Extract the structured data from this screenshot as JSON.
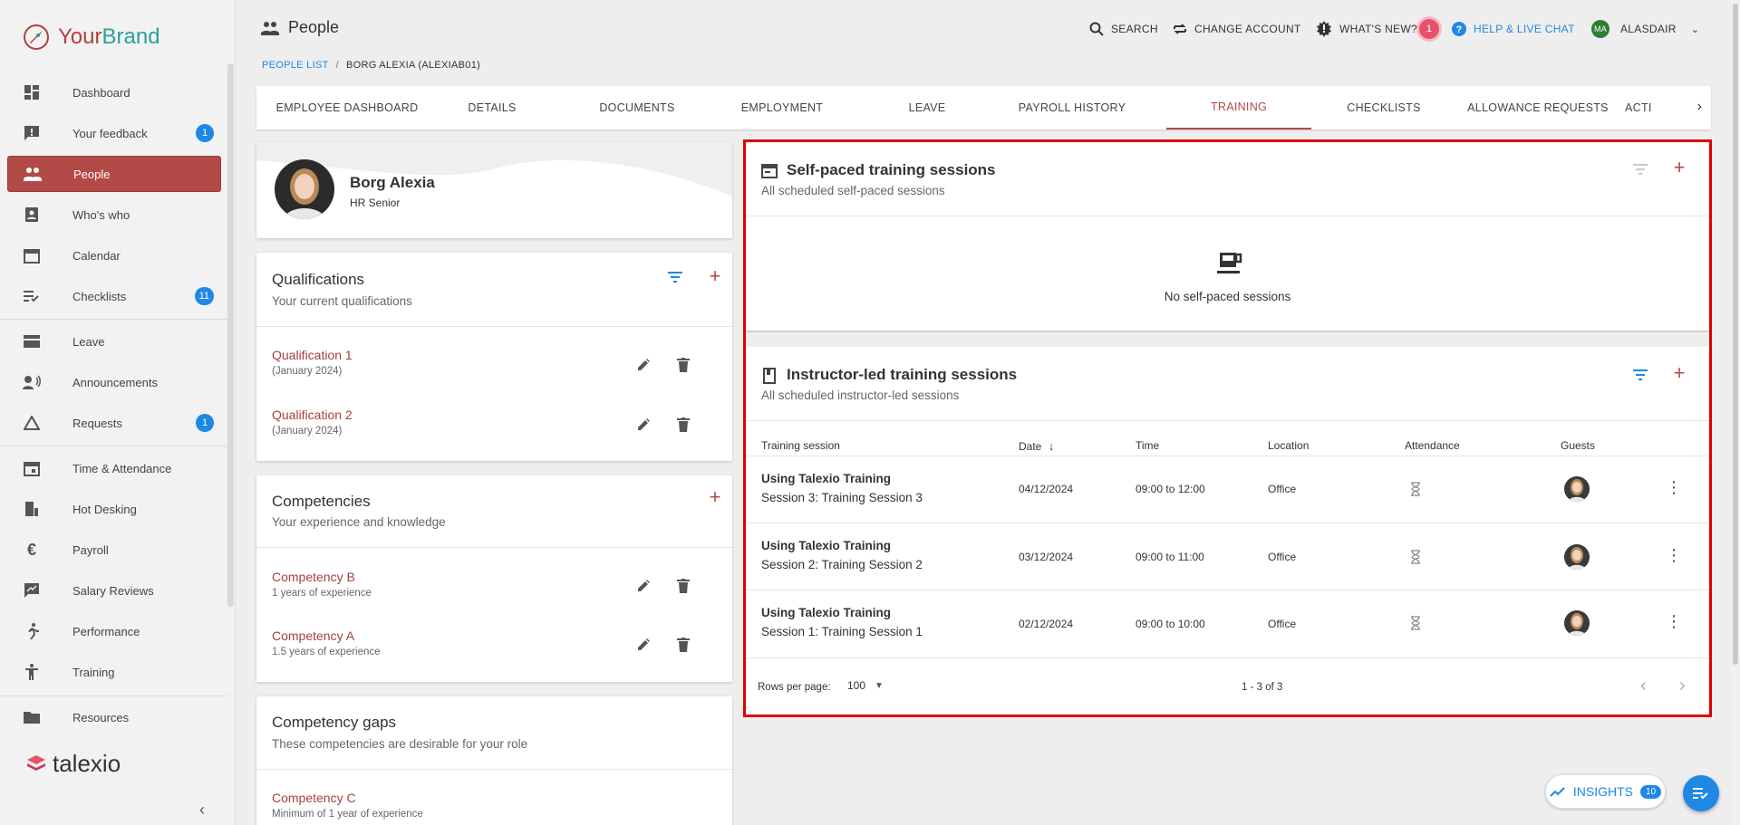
{
  "brand": {
    "part1": "Your",
    "part2": "Brand"
  },
  "sidebar": {
    "items": [
      {
        "label": "Dashboard",
        "icon": "dashboard-icon",
        "badge": ""
      },
      {
        "label": "Your feedback",
        "icon": "feedback-icon",
        "badge": "1"
      },
      {
        "label": "People",
        "icon": "people-icon",
        "badge": ""
      },
      {
        "label": "Who's who",
        "icon": "contact-icon",
        "badge": ""
      },
      {
        "label": "Calendar",
        "icon": "calendar-icon",
        "badge": ""
      },
      {
        "label": "Checklists",
        "icon": "checklist-icon",
        "badge": "11"
      },
      {
        "label": "Leave",
        "icon": "leave-icon",
        "badge": ""
      },
      {
        "label": "Announcements",
        "icon": "announcement-icon",
        "badge": ""
      },
      {
        "label": "Requests",
        "icon": "requests-icon",
        "badge": "1"
      },
      {
        "label": "Time & Attendance",
        "icon": "time-icon",
        "badge": ""
      },
      {
        "label": "Hot Desking",
        "icon": "desk-icon",
        "badge": ""
      },
      {
        "label": "Payroll",
        "icon": "euro-icon",
        "badge": ""
      },
      {
        "label": "Salary Reviews",
        "icon": "salary-review-icon",
        "badge": ""
      },
      {
        "label": "Performance",
        "icon": "performance-icon",
        "badge": ""
      },
      {
        "label": "Training",
        "icon": "training-icon",
        "badge": ""
      },
      {
        "label": "Resources",
        "icon": "folder-icon",
        "badge": ""
      }
    ],
    "footer_logo": "talexio"
  },
  "header": {
    "title": "People",
    "search": "SEARCH",
    "change_account": "CHANGE ACCOUNT",
    "whats_new": "WHAT'S NEW?",
    "whats_new_count": "1",
    "help": "HELP & LIVE CHAT",
    "user_initials": "MA",
    "user": "ALASDAIR"
  },
  "breadcrumb": {
    "link": "PEOPLE LIST",
    "sep": "/",
    "current": "BORG ALEXIA (ALEXIAB01)"
  },
  "tabs": [
    "EMPLOYEE DASHBOARD",
    "DETAILS",
    "DOCUMENTS",
    "EMPLOYMENT",
    "LEAVE",
    "PAYROLL HISTORY",
    "TRAINING",
    "CHECKLISTS",
    "ALLOWANCE REQUESTS",
    "ACTI"
  ],
  "profile": {
    "name": "Borg Alexia",
    "role": "HR Senior"
  },
  "qualifications": {
    "title": "Qualifications",
    "subtitle": "Your current qualifications",
    "items": [
      {
        "name": "Qualification 1",
        "date": "(January 2024)"
      },
      {
        "name": "Qualification 2",
        "date": "(January 2024)"
      }
    ]
  },
  "competencies": {
    "title": "Competencies",
    "subtitle": "Your experience and knowledge",
    "items": [
      {
        "name": "Competency B",
        "detail": "1 years of experience"
      },
      {
        "name": "Competency A",
        "detail": "1.5 years of experience"
      }
    ]
  },
  "gaps": {
    "title": "Competency gaps",
    "subtitle": "These competencies are desirable for your role",
    "items": [
      {
        "name": "Competency C",
        "detail": "Minimum of 1 year of experience"
      }
    ]
  },
  "self_paced": {
    "title": "Self-paced training sessions",
    "subtitle": "All scheduled self-paced sessions",
    "empty": "No self-paced sessions"
  },
  "instructor": {
    "title": "Instructor-led training sessions",
    "subtitle": "All scheduled instructor-led sessions",
    "columns": [
      "Training session",
      "Date",
      "Time",
      "Location",
      "Attendance",
      "Guests"
    ],
    "rows": [
      {
        "course": "Using Talexio Training",
        "session": "Session 3: Training Session 3",
        "date": "04/12/2024",
        "time": "09:00 to 12:00",
        "location": "Office"
      },
      {
        "course": "Using Talexio Training",
        "session": "Session 2: Training Session 2",
        "date": "03/12/2024",
        "time": "09:00 to 11:00",
        "location": "Office"
      },
      {
        "course": "Using Talexio Training",
        "session": "Session 1: Training Session 1",
        "date": "02/12/2024",
        "time": "09:00 to 10:00",
        "location": "Office"
      }
    ],
    "rows_per_page_label": "Rows per page:",
    "rows_per_page": "100",
    "range": "1 - 3 of 3"
  },
  "insights": {
    "label": "INSIGHTS",
    "count": "10"
  },
  "colors": {
    "accent": "#b24a48",
    "blue": "#1e88e5",
    "highlight": "#e00000"
  }
}
